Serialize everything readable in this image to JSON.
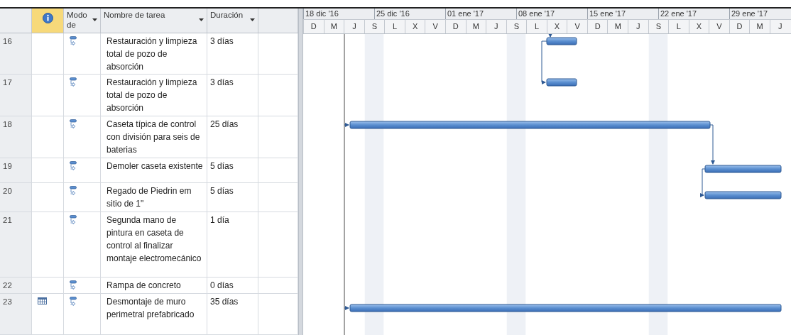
{
  "table": {
    "columns": [
      {
        "label": "Modo de",
        "filter": true
      },
      {
        "label": "Nombre de tarea",
        "filter": true
      },
      {
        "label": "Duración",
        "filter": true
      }
    ],
    "rows": [
      {
        "id": "16",
        "kind": "task",
        "name": "Restauración y limpieza total de pozo de absorción",
        "duration": "3 días"
      },
      {
        "id": "17",
        "kind": "task",
        "name": "Restauración y limpieza total de pozo de absorción",
        "duration": "3 días"
      },
      {
        "id": "18",
        "kind": "task",
        "name": "Caseta típica de control con división para seis de baterias",
        "duration": "25 días"
      },
      {
        "id": "19",
        "kind": "task",
        "name": "Demoler caseta existente",
        "duration": "5 días"
      },
      {
        "id": "20",
        "kind": "task",
        "name": "Regado de Piedrin em sitio de 1\"",
        "duration": "5 días"
      },
      {
        "id": "21",
        "kind": "task",
        "name": "Segunda mano de pintura en caseta de control al finalizar montaje electromecánico",
        "duration": "1 día"
      },
      {
        "id": "22",
        "kind": "task",
        "name": "Rampa de concreto",
        "duration": "0 días"
      },
      {
        "id": "23",
        "kind": "calendar",
        "name": "Desmontaje de muro perimetral prefabricado",
        "duration": "35 días"
      }
    ]
  },
  "timeline": {
    "weeks": [
      "18 dic '16",
      "25 dic '16",
      "01 ene '17",
      "08 ene '17",
      "15 ene '17",
      "22 ene '17",
      "29 ene '17"
    ],
    "days": [
      "D",
      "M",
      "J",
      "S",
      "L",
      "X",
      "V",
      "D",
      "M",
      "J",
      "S",
      "L",
      "X",
      "V",
      "D",
      "M",
      "J",
      "S",
      "L",
      "X",
      "V",
      "D",
      "M",
      "J"
    ]
  }
}
